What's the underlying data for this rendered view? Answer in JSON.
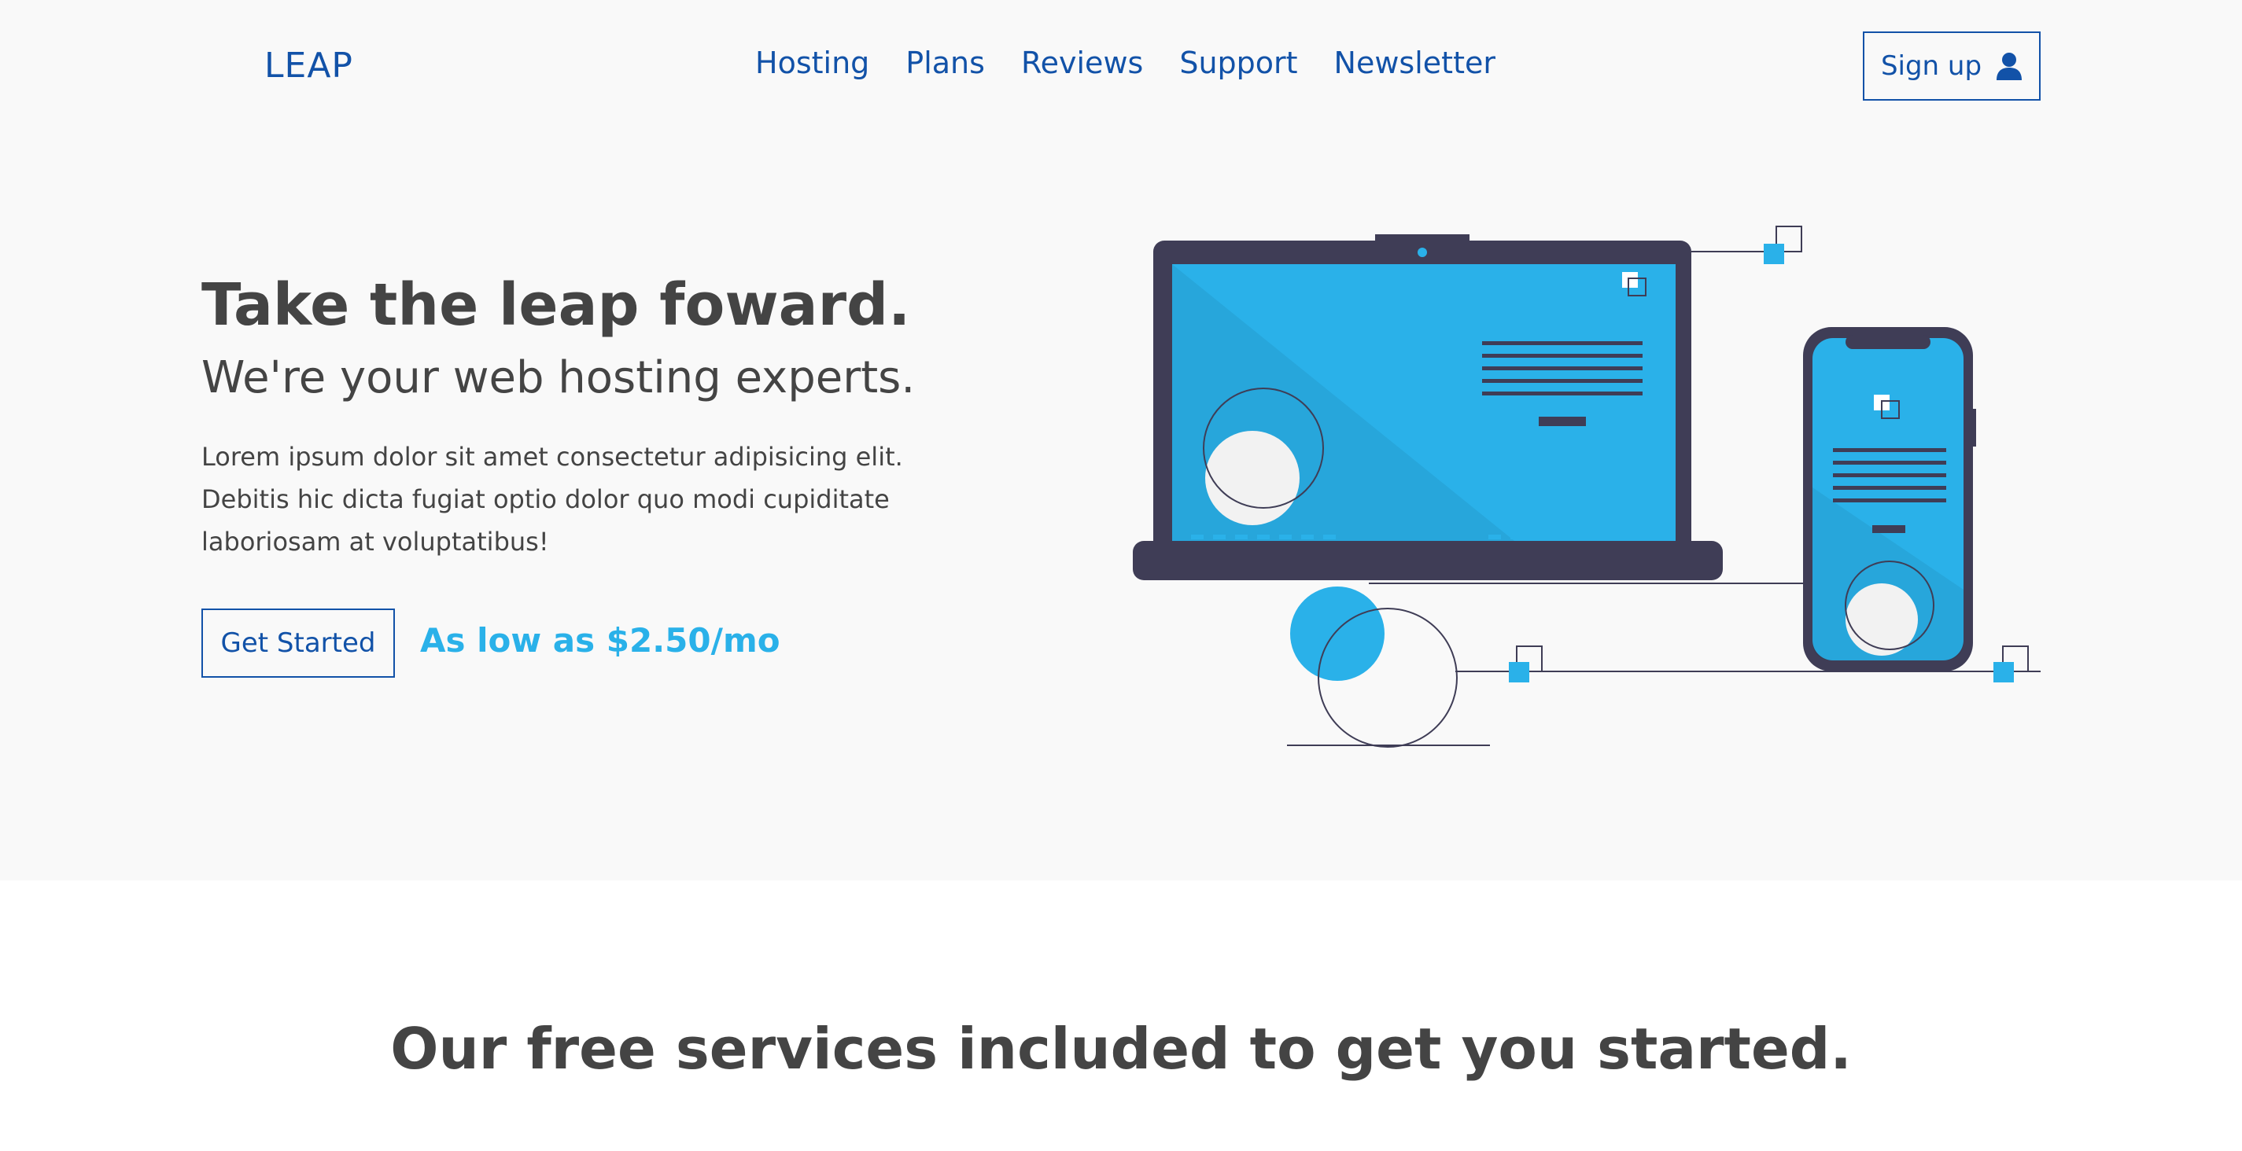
{
  "header": {
    "logo": "LEAP",
    "nav": [
      "Hosting",
      "Plans",
      "Reviews",
      "Support",
      "Newsletter"
    ],
    "signup_label": "Sign up",
    "signup_icon": "user-icon"
  },
  "hero": {
    "title": "Take the leap foward.",
    "subtitle": "We're your web hosting experts.",
    "paragraph": "Lorem ipsum dolor sit amet consectetur adipisicing elit. Debitis hic dicta fugiat optio dolor quo modi cupiditate laboriosam at voluptatibus!",
    "cta_label": "Get Started",
    "price": "As low as $2.50/mo",
    "illustration": "devices-illustration"
  },
  "services": {
    "title": "Our free services included to get you started."
  },
  "colors": {
    "brand_blue": "#1252a8",
    "accent_cyan": "#2ab1e9",
    "dark_device": "#3f3d56",
    "text": "#444444",
    "hero_bg": "#f9f9f9"
  }
}
